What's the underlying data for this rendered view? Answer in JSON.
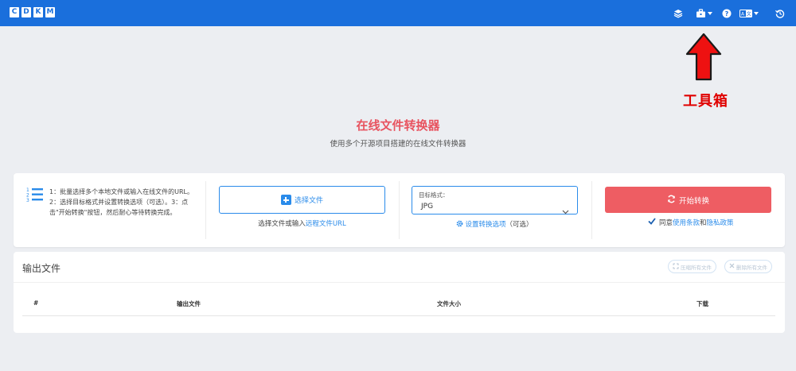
{
  "header": {
    "logo_letters": [
      "C",
      "D",
      "K",
      "M"
    ],
    "icons": [
      "layers-icon",
      "toolbox-icon",
      "help-icon",
      "language-icon",
      "history-icon"
    ],
    "bg_color": "#1a6fdc"
  },
  "annotation": {
    "label": "工具箱",
    "color": "#e00000"
  },
  "hero": {
    "title": "在线文件转换器",
    "subtitle": "使用多个开源项目搭建的在线文件转换器"
  },
  "steps": {
    "text": "1：批量选择多个本地文件或输入在线文件的URL。2：选择目标格式并设置转换选项（可选）。3：点击\"开始转换\"按钮，然后耐心等待转换完成。"
  },
  "choose": {
    "button_label": "选择文件",
    "hint_prefix": "选择文件或输入",
    "hint_link": "远程文件URL"
  },
  "format": {
    "label": "目标格式：",
    "value": "JPG",
    "options_link": "设置转换选项",
    "options_suffix": "（可选）"
  },
  "start": {
    "button_label": "开始转换",
    "agree_prefix": "同意",
    "terms_link": "使用条款",
    "and": "和",
    "privacy_link": "隐私政策",
    "color": "#ee5d63"
  },
  "output": {
    "title": "输出文件",
    "compress_all": "压缩所有文件",
    "delete_all": "删除所有文件",
    "columns": [
      "#",
      "输出文件",
      "文件大小",
      "下载"
    ]
  }
}
